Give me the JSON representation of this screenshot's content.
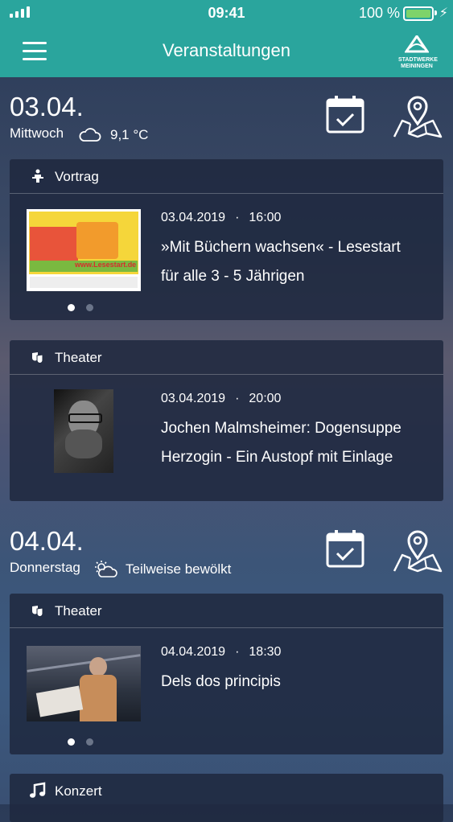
{
  "status": {
    "time": "09:41",
    "battery": "100 %",
    "battery_level": 1.0
  },
  "nav": {
    "title": "Veranstaltungen",
    "logo_line1": "STADTWERKE",
    "logo_line2": "MEININGEN"
  },
  "days": [
    {
      "date": "03.04.",
      "weekday": "Mittwoch",
      "weather_icon": "cloud-icon",
      "weather": "9,1 °C",
      "events": [
        {
          "category": "Vortrag",
          "category_icon": "lecture-icon",
          "date": "03.04.2019",
          "time": "16:00",
          "title_line1": "»Mit Büchern wachsen«  - Lesestart",
          "title_line2": "für alle 3 - 5 Jährigen",
          "image_text": "www.Lesestart.de",
          "has_dots": true
        },
        {
          "category": "Theater",
          "category_icon": "theater-masks-icon",
          "date": "03.04.2019",
          "time": "20:00",
          "title_line1": "Jochen Malmsheimer: Dogensuppe",
          "title_line2": "Herzogin - Ein Austopf mit Einlage",
          "has_dots": false
        }
      ]
    },
    {
      "date": "04.04.",
      "weekday": "Donnerstag",
      "weather_icon": "partly-cloudy-icon",
      "weather": "Teilweise bewölkt",
      "events": [
        {
          "category": "Theater",
          "category_icon": "theater-masks-icon",
          "date": "04.04.2019",
          "time": "18:30",
          "title_line1": "Dels dos principis",
          "title_line2": "",
          "has_dots": true
        },
        {
          "category": "Konzert",
          "category_icon": "music-note-icon"
        }
      ]
    }
  ],
  "meta_separator": "·",
  "colors": {
    "accent": "#2aa59d",
    "card": "#1e283e",
    "battery": "#7ed36a"
  }
}
